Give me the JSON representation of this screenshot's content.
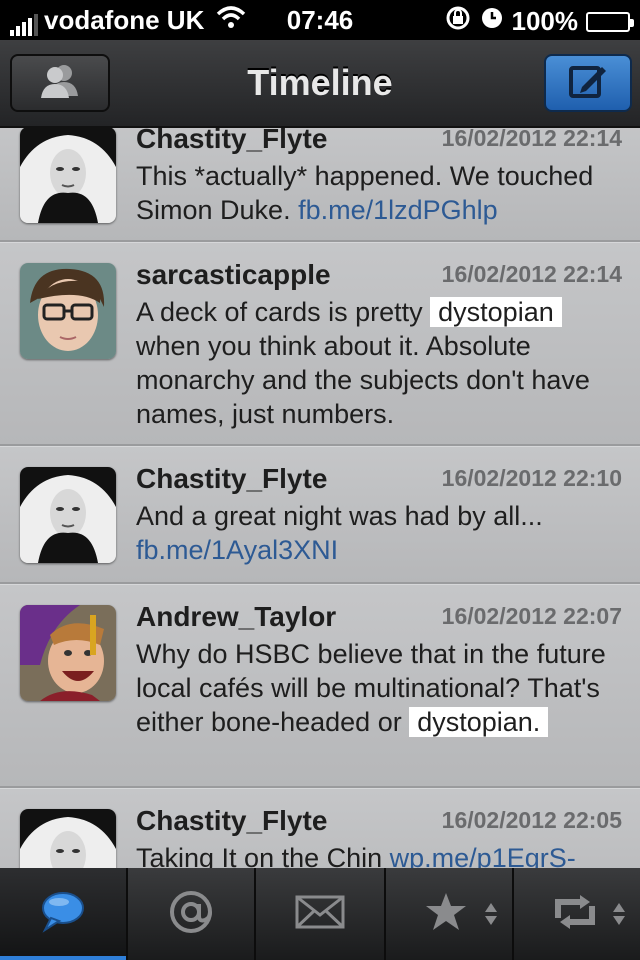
{
  "status_bar": {
    "carrier": "vodafone UK",
    "time": "07:46",
    "battery": "100%",
    "signal_bars_filled": 4,
    "icons": [
      "signal-icon",
      "wifi-icon",
      "rotation-lock-icon",
      "alarm-icon",
      "battery-icon"
    ]
  },
  "nav": {
    "title": "Timeline",
    "left_button_icon": "accounts-icon",
    "right_button_icon": "compose-icon",
    "accent_color": "#2a6fc2"
  },
  "tweets": [
    {
      "author": "Chastity_Flyte",
      "timestamp": "16/02/2012 22:14",
      "text_parts": [
        {
          "t": "This *actually* happened.  We touched Simon Duke. "
        },
        {
          "t": "fb.me/1lzdPGhlp",
          "link": true
        }
      ],
      "avatar": "woman-portrait"
    },
    {
      "author": "sarcasticapple",
      "timestamp": "16/02/2012 22:14",
      "text_parts": [
        {
          "t": "A deck of cards is pretty "
        },
        {
          "t": "dystopian",
          "highlight": true
        },
        {
          "t": " when you think about it. Absolute monarchy and the subjects don't have names, just numbers."
        }
      ],
      "avatar": "man-glasses"
    },
    {
      "author": "Chastity_Flyte",
      "timestamp": "16/02/2012 22:10",
      "text_parts": [
        {
          "t": "And a great night was had by all... "
        },
        {
          "t": "fb.me/1Ayal3XNI",
          "link": true
        }
      ],
      "avatar": "woman-portrait"
    },
    {
      "author": "Andrew_Taylor",
      "timestamp": "16/02/2012 22:07",
      "text_parts": [
        {
          "t": "Why do HSBC believe that in the future local cafés will be multinational? That's either bone-headed or "
        },
        {
          "t": "dystopian.",
          "highlight": true
        }
      ],
      "avatar": "graduate-laughing"
    },
    {
      "author": "Chastity_Flyte",
      "timestamp": "16/02/2012 22:05",
      "text_parts": [
        {
          "t": "Taking It on the Chin "
        },
        {
          "t": "wp.me/p1EgrS-",
          "link": true
        }
      ],
      "avatar": "woman-portrait"
    }
  ],
  "tabs": [
    {
      "icon": "timeline-bubble-icon",
      "active": true
    },
    {
      "icon": "mentions-icon",
      "active": false
    },
    {
      "icon": "messages-icon",
      "active": false
    },
    {
      "icon": "favorites-icon",
      "active": false,
      "has_selector": true
    },
    {
      "icon": "retweets-icon",
      "active": false,
      "has_selector": true
    }
  ]
}
